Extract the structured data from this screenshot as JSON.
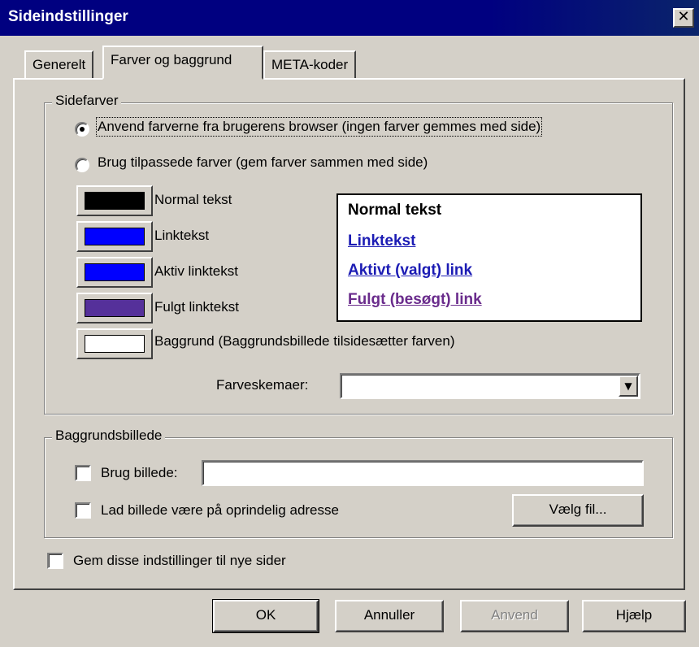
{
  "window": {
    "title": "Sideindstillinger",
    "close_glyph": "✕"
  },
  "tabs": [
    {
      "label": "Generelt"
    },
    {
      "label": "Farver og baggrund",
      "active": true
    },
    {
      "label": "META-koder"
    }
  ],
  "sidefarver": {
    "legend": "Sidefarver",
    "radio_browser": "Anvend farverne fra brugerens browser (ingen farver gemmes med side)",
    "radio_custom": "Brug tilpassede farver (gem farver sammen med side)",
    "colors": [
      {
        "label": "Normal tekst",
        "swatch": "#000000"
      },
      {
        "label": "Linktekst",
        "swatch": "#0000ff"
      },
      {
        "label": "Aktiv linktekst",
        "swatch": "#0000ff"
      },
      {
        "label": "Fulgt linktekst",
        "swatch": "#55309a"
      },
      {
        "label": "Baggrund (Baggrundsbillede tilsidesætter farven)",
        "swatch": "#ffffff"
      }
    ],
    "preview": {
      "normal": "Normal tekst",
      "link": "Linktekst",
      "active": "Aktivt (valgt) link",
      "visited": "Fulgt (besøgt) link",
      "link_color": "#1c1cb4",
      "visited_color": "#6a2c8c"
    },
    "scheme_label": "Farveskemaer:",
    "scheme_value": ""
  },
  "baggrundsbillede": {
    "legend": "Baggrundsbillede",
    "use_image_label": "Brug billede:",
    "use_image_value": "",
    "keep_location_label": "Lad billede være på oprindelig adresse",
    "choose_file_button": "Vælg fil..."
  },
  "save_settings_label": "Gem disse indstillinger til nye sider",
  "buttons": {
    "ok": "OK",
    "cancel": "Annuller",
    "apply": "Anvend",
    "help": "Hjælp"
  }
}
